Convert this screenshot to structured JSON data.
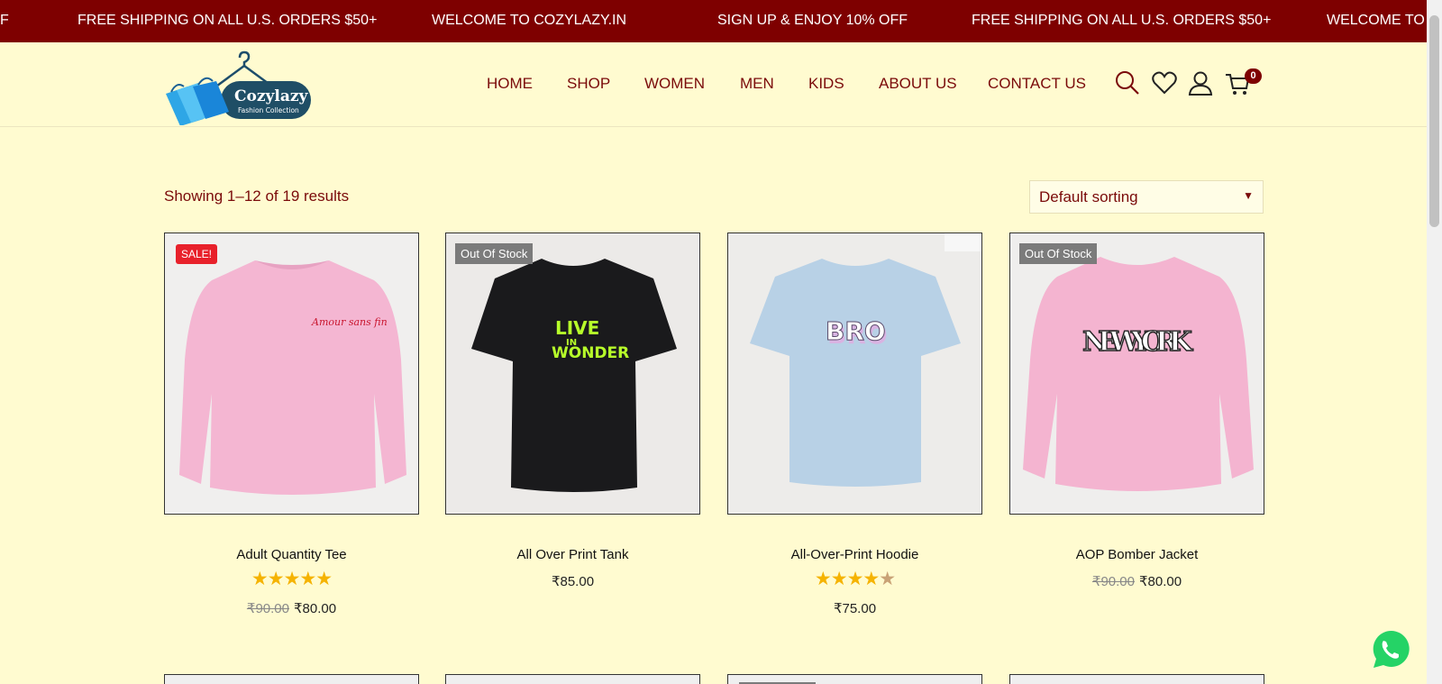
{
  "announcements": [
    "F",
    "FREE SHIPPING ON ALL U.S. ORDERS $50+",
    "WELCOME TO COZYLAZY.IN",
    "SIGN UP & ENJOY 10% OFF",
    "FREE SHIPPING ON ALL U.S. ORDERS $50+",
    "WELCOME TO"
  ],
  "brand": {
    "name": "Cozylazy",
    "tagline": "Fashion Collection"
  },
  "nav": [
    "HOME",
    "SHOP",
    "WOMEN",
    "MEN",
    "KIDS",
    "ABOUT US",
    "CONTACT US"
  ],
  "header_icons": [
    "search-icon",
    "wishlist-heart-icon",
    "account-user-icon",
    "cart-icon"
  ],
  "cart": {
    "count": "0"
  },
  "toolbar": {
    "result_count": "Showing 1–12 of 19 results",
    "sort_selected": "Default sorting"
  },
  "products": [
    {
      "name": "Adult Quantity Tee",
      "badge": "SALE!",
      "rating": 5,
      "old_price": "₹90.00",
      "price": "₹80.00",
      "image": "pink sweatshirt with red script print"
    },
    {
      "name": "All Over Print Tank",
      "badge": "Out Of Stock",
      "rating": null,
      "old_price": "",
      "price": "₹85.00",
      "image": "black t-shirt LIVE IN WONDER"
    },
    {
      "name": "All-Over-Print Hoodie",
      "badge": "",
      "rating": 4.5,
      "old_price": "",
      "price": "₹75.00",
      "image": "light blue t-shirt BRO"
    },
    {
      "name": "AOP Bomber Jacket",
      "badge": "Out Of Stock",
      "rating": null,
      "old_price": "₹90.00",
      "price": "₹80.00",
      "image": "pink sweatshirt NEW YORK"
    }
  ],
  "image_text": {
    "p1": "Amour sans fin",
    "p2_l1": "LIVE",
    "p2_l2": "IN",
    "p2_l3": "WONDER",
    "p3": "BRO",
    "p4": "NEW YORK"
  },
  "colors": {
    "topbar": "#7e0000",
    "background": "#fffbd0",
    "nav_text": "#7a0a0a",
    "sale_badge": "#e8212b",
    "oos_badge": "#7b7b7b",
    "star": "#f5b301"
  }
}
